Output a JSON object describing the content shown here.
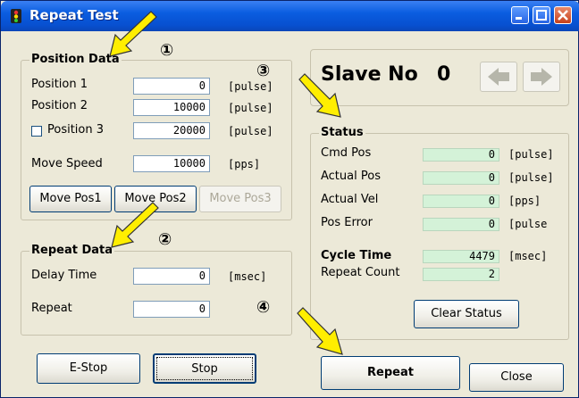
{
  "window": {
    "title": "Repeat Test"
  },
  "position_data": {
    "title": "Position Data",
    "rows": [
      {
        "label": "Position 1",
        "value": "0",
        "unit": "[pulse]"
      },
      {
        "label": "Position 2",
        "value": "10000",
        "unit": "[pulse]"
      },
      {
        "label": "Position 3",
        "value": "20000",
        "unit": "[pulse]"
      }
    ],
    "move_speed": {
      "label": "Move Speed",
      "value": "10000",
      "unit": "[pps]"
    },
    "buttons": [
      "Move Pos1",
      "Move Pos2",
      "Move Pos3"
    ]
  },
  "repeat_data": {
    "title": "Repeat Data",
    "delay": {
      "label": "Delay Time",
      "value": "0",
      "unit": "[msec]"
    },
    "repeat": {
      "label": "Repeat",
      "value": "0"
    }
  },
  "slave": {
    "label": "Slave No",
    "number": "0"
  },
  "status": {
    "title": "Status",
    "rows": [
      {
        "label": "Cmd Pos",
        "value": "0",
        "unit": "[pulse]"
      },
      {
        "label": "Actual Pos",
        "value": "0",
        "unit": "[pulse]"
      },
      {
        "label": "Actual Vel",
        "value": "0",
        "unit": "[pps]"
      },
      {
        "label": "Pos Error",
        "value": "0",
        "unit": "[pulse"
      }
    ],
    "cycle_time": {
      "label": "Cycle Time",
      "value": "4479",
      "unit": "[msec]"
    },
    "repeat_count": {
      "label": "Repeat Count",
      "value": "2"
    },
    "clear_label": "Clear Status"
  },
  "bottom_buttons": {
    "estop": "E-Stop",
    "stop": "Stop",
    "repeat": "Repeat",
    "close": "Close"
  },
  "annotations": {
    "m1": "①",
    "m2": "②",
    "m3": "③",
    "m4": "④"
  },
  "colors": {
    "arrow_fill": "#ffee00",
    "status_field": "#d4f2d8",
    "titlebar": "#0a5de0"
  }
}
